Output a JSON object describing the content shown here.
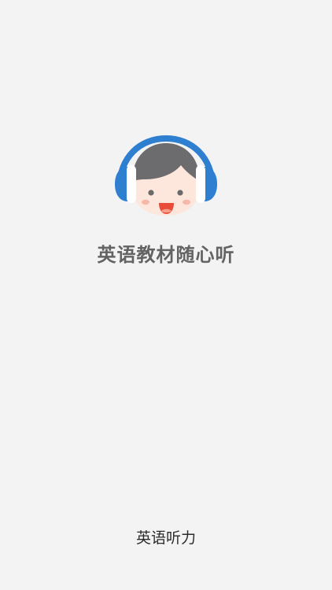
{
  "app": {
    "title": "英语教材随心听",
    "footer_label": "英语听力"
  },
  "logo": {
    "icon": "kid-with-headphones-icon",
    "colors": {
      "headphone": "#2e7fd0",
      "hair": "#6c6c6e",
      "face": "#fde6dc",
      "cheek": "#f7b7a8",
      "mouth": "#e84c38"
    }
  },
  "colors": {
    "background": "#f3f3f3",
    "title_text": "#636363",
    "footer_text": "#2b2b2b"
  }
}
